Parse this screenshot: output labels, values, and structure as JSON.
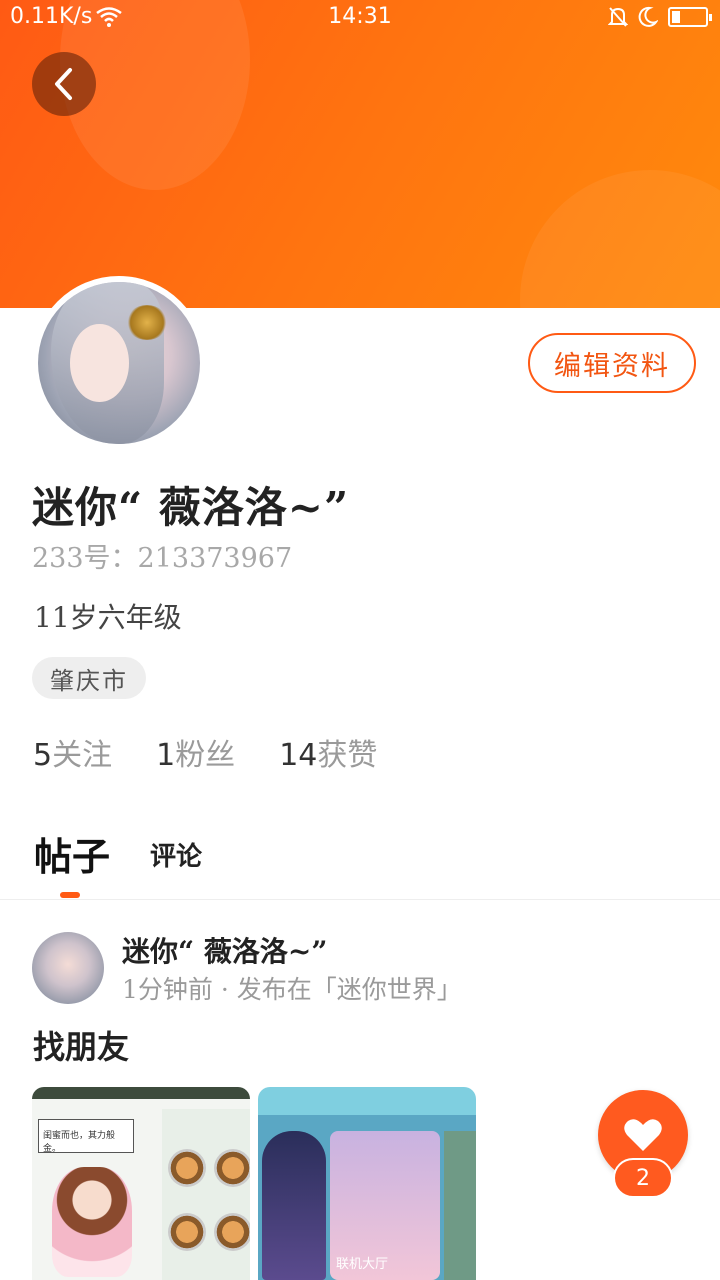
{
  "status_bar": {
    "network_speed": "0.11K/s",
    "time": "14:31"
  },
  "colors": {
    "accent": "#ff5a14",
    "banner_start": "#ff5a14",
    "banner_end": "#ff8a0c"
  },
  "profile": {
    "edit_label": "编辑资料",
    "username": "迷你“ 薇洛洛~”",
    "uid": "233号：213373967",
    "age_grade": "11岁六年级",
    "location": "肇庆市",
    "stats": [
      {
        "num": "5",
        "label": "关注"
      },
      {
        "num": "1",
        "label": "粉丝"
      },
      {
        "num": "14",
        "label": "获赞"
      }
    ]
  },
  "tabs": [
    {
      "label": "帖子",
      "active": true
    },
    {
      "label": "评论",
      "active": false
    }
  ],
  "post": {
    "author": "迷你“ 薇洛洛~”",
    "meta": "1分钟前 · 发布在「迷你世界」",
    "title": "找朋友",
    "thumb1_caption": "闺蜜而也，其力般金。",
    "thumb2_caption": "联机大厅",
    "like_count": "2"
  },
  "icons": {
    "back": "chevron-left-icon",
    "wifi": "wifi-icon",
    "mute": "bell-off-icon",
    "dnd": "moon-icon",
    "battery": "battery-icon",
    "like": "heart-icon"
  }
}
